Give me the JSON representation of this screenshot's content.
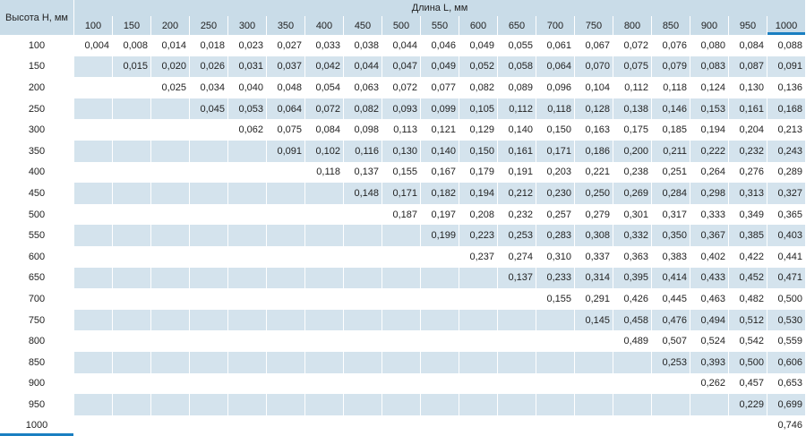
{
  "table": {
    "row_header": "Высота Н, мм",
    "col_header": "Длина L, мм",
    "columns": [
      "100",
      "150",
      "200",
      "250",
      "300",
      "350",
      "400",
      "450",
      "500",
      "550",
      "600",
      "650",
      "700",
      "750",
      "800",
      "850",
      "900",
      "950",
      "1000"
    ],
    "rows": [
      {
        "h": "100",
        "v": [
          "0,004",
          "0,008",
          "0,014",
          "0,018",
          "0,023",
          "0,027",
          "0,033",
          "0,038",
          "0,044",
          "0,046",
          "0,049",
          "0,055",
          "0,061",
          "0,067",
          "0,072",
          "0,076",
          "0,080",
          "0,084",
          "0,088"
        ]
      },
      {
        "h": "150",
        "v": [
          "",
          "0,015",
          "0,020",
          "0,026",
          "0,031",
          "0,037",
          "0,042",
          "0,044",
          "0,047",
          "0,049",
          "0,052",
          "0,058",
          "0,064",
          "0,070",
          "0,075",
          "0,079",
          "0,083",
          "0,087",
          "0,091"
        ]
      },
      {
        "h": "200",
        "v": [
          "",
          "",
          "0,025",
          "0,034",
          "0,040",
          "0,048",
          "0,054",
          "0,063",
          "0,072",
          "0,077",
          "0,082",
          "0,089",
          "0,096",
          "0,104",
          "0,112",
          "0,118",
          "0,124",
          "0,130",
          "0,136"
        ]
      },
      {
        "h": "250",
        "v": [
          "",
          "",
          "",
          "0,045",
          "0,053",
          "0,064",
          "0,072",
          "0,082",
          "0,093",
          "0,099",
          "0,105",
          "0,112",
          "0,118",
          "0,128",
          "0,138",
          "0,146",
          "0,153",
          "0,161",
          "0,168"
        ]
      },
      {
        "h": "300",
        "v": [
          "",
          "",
          "",
          "",
          "0,062",
          "0,075",
          "0,084",
          "0,098",
          "0,113",
          "0,121",
          "0,129",
          "0,140",
          "0,150",
          "0,163",
          "0,175",
          "0,185",
          "0,194",
          "0,204",
          "0,213"
        ]
      },
      {
        "h": "350",
        "v": [
          "",
          "",
          "",
          "",
          "",
          "0,091",
          "0,102",
          "0,116",
          "0,130",
          "0,140",
          "0,150",
          "0,161",
          "0,171",
          "0,186",
          "0,200",
          "0,211",
          "0,222",
          "0,232",
          "0,243"
        ]
      },
      {
        "h": "400",
        "v": [
          "",
          "",
          "",
          "",
          "",
          "",
          "0,118",
          "0,137",
          "0,155",
          "0,167",
          "0,179",
          "0,191",
          "0,203",
          "0,221",
          "0,238",
          "0,251",
          "0,264",
          "0,276",
          "0,289"
        ]
      },
      {
        "h": "450",
        "v": [
          "",
          "",
          "",
          "",
          "",
          "",
          "",
          "0,148",
          "0,171",
          "0,182",
          "0,194",
          "0,212",
          "0,230",
          "0,250",
          "0,269",
          "0,284",
          "0,298",
          "0,313",
          "0,327"
        ]
      },
      {
        "h": "500",
        "v": [
          "",
          "",
          "",
          "",
          "",
          "",
          "",
          "",
          "0,187",
          "0,197",
          "0,208",
          "0,232",
          "0,257",
          "0,279",
          "0,301",
          "0,317",
          "0,333",
          "0,349",
          "0,365"
        ]
      },
      {
        "h": "550",
        "v": [
          "",
          "",
          "",
          "",
          "",
          "",
          "",
          "",
          "",
          "0,199",
          "0,223",
          "0,253",
          "0,283",
          "0,308",
          "0,332",
          "0,350",
          "0,367",
          "0,385",
          "0,403"
        ]
      },
      {
        "h": "600",
        "v": [
          "",
          "",
          "",
          "",
          "",
          "",
          "",
          "",
          "",
          "",
          "0,237",
          "0,274",
          "0,310",
          "0,337",
          "0,363",
          "0,383",
          "0,402",
          "0,422",
          "0,441"
        ]
      },
      {
        "h": "650",
        "v": [
          "",
          "",
          "",
          "",
          "",
          "",
          "",
          "",
          "",
          "",
          "",
          "0,137",
          "0,233",
          "0,314",
          "0,395",
          "0,414",
          "0,433",
          "0,452",
          "0,471"
        ]
      },
      {
        "h": "700",
        "v": [
          "",
          "",
          "",
          "",
          "",
          "",
          "",
          "",
          "",
          "",
          "",
          "",
          "0,155",
          "0,291",
          "0,426",
          "0,445",
          "0,463",
          "0,482",
          "0,500"
        ]
      },
      {
        "h": "750",
        "v": [
          "",
          "",
          "",
          "",
          "",
          "",
          "",
          "",
          "",
          "",
          "",
          "",
          "",
          "0,145",
          "0,458",
          "0,476",
          "0,494",
          "0,512",
          "0,530"
        ]
      },
      {
        "h": "800",
        "v": [
          "",
          "",
          "",
          "",
          "",
          "",
          "",
          "",
          "",
          "",
          "",
          "",
          "",
          "",
          "0,489",
          "0,507",
          "0,524",
          "0,542",
          "0,559"
        ]
      },
      {
        "h": "850",
        "v": [
          "",
          "",
          "",
          "",
          "",
          "",
          "",
          "",
          "",
          "",
          "",
          "",
          "",
          "",
          "",
          "0,253",
          "0,393",
          "0,500",
          "0,606"
        ]
      },
      {
        "h": "900",
        "v": [
          "",
          "",
          "",
          "",
          "",
          "",
          "",
          "",
          "",
          "",
          "",
          "",
          "",
          "",
          "",
          "",
          "0,262",
          "0,457",
          "0,653"
        ]
      },
      {
        "h": "950",
        "v": [
          "",
          "",
          "",
          "",
          "",
          "",
          "",
          "",
          "",
          "",
          "",
          "",
          "",
          "",
          "",
          "",
          "",
          "0,229",
          "0,699"
        ]
      },
      {
        "h": "1000",
        "v": [
          "",
          "",
          "",
          "",
          "",
          "",
          "",
          "",
          "",
          "",
          "",
          "",
          "",
          "",
          "",
          "",
          "",
          "",
          "0,746"
        ]
      }
    ]
  },
  "colors": {
    "header_bg": "#c9dce8",
    "stripe_bg": "#d4e3ed",
    "accent": "#1a7fc1"
  }
}
